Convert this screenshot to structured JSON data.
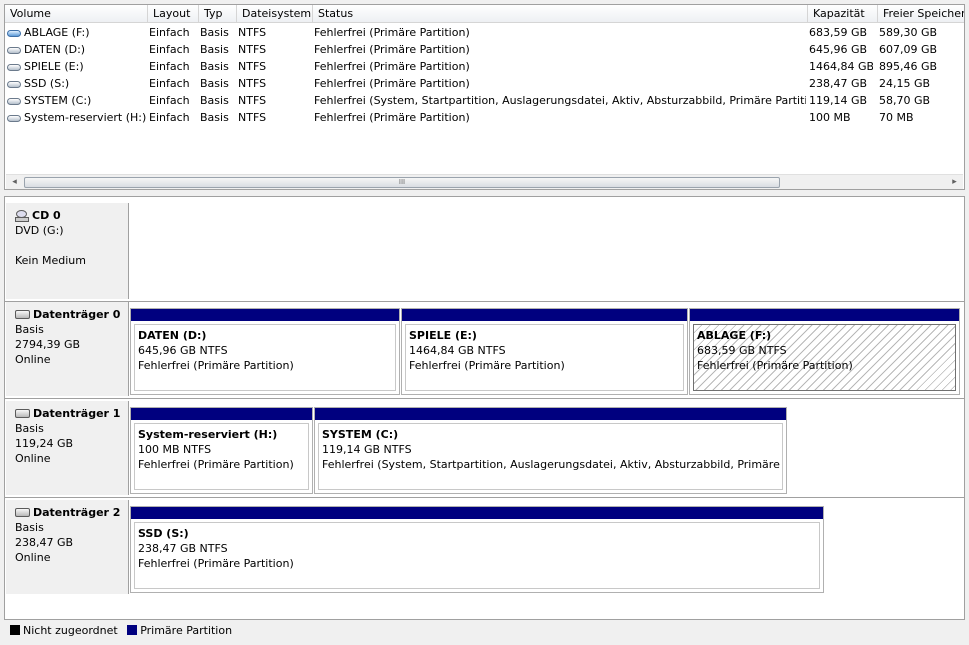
{
  "columns": [
    "Volume",
    "Layout",
    "Typ",
    "Dateisystem",
    "Status",
    "Kapazität",
    "Freier Speicher"
  ],
  "volumes": [
    {
      "name": "ABLAGE (F:)",
      "layout": "Einfach",
      "type": "Basis",
      "fs": "NTFS",
      "status": "Fehlerfrei (Primäre Partition)",
      "capacity": "683,59 GB",
      "free": "589,30 GB",
      "icon": "volume-icon-blue"
    },
    {
      "name": "DATEN (D:)",
      "layout": "Einfach",
      "type": "Basis",
      "fs": "NTFS",
      "status": "Fehlerfrei (Primäre Partition)",
      "capacity": "645,96 GB",
      "free": "607,09 GB",
      "icon": "volume-icon"
    },
    {
      "name": "SPIELE (E:)",
      "layout": "Einfach",
      "type": "Basis",
      "fs": "NTFS",
      "status": "Fehlerfrei (Primäre Partition)",
      "capacity": "1464,84 GB",
      "free": "895,46 GB",
      "icon": "volume-icon"
    },
    {
      "name": "SSD (S:)",
      "layout": "Einfach",
      "type": "Basis",
      "fs": "NTFS",
      "status": "Fehlerfrei (Primäre Partition)",
      "capacity": "238,47 GB",
      "free": "24,15 GB",
      "icon": "volume-icon"
    },
    {
      "name": "SYSTEM (C:)",
      "layout": "Einfach",
      "type": "Basis",
      "fs": "NTFS",
      "status": "Fehlerfrei (System, Startpartition, Auslagerungsdatei, Aktiv, Absturzabbild, Primäre Partition)",
      "capacity": "119,14 GB",
      "free": "58,70 GB",
      "icon": "volume-icon"
    },
    {
      "name": "System-reserviert (H:)",
      "layout": "Einfach",
      "type": "Basis",
      "fs": "NTFS",
      "status": "Fehlerfrei (Primäre Partition)",
      "capacity": "100 MB",
      "free": "70 MB",
      "icon": "volume-icon"
    }
  ],
  "scrollbar": {
    "left_arrow": "◂",
    "right_arrow": "▸",
    "grip": "III"
  },
  "disks": [
    {
      "title": "CD 0",
      "line1": "DVD (G:)",
      "line2": "",
      "line3": "Kein Medium",
      "icon": "cd-drive-icon"
    },
    {
      "title": "Datenträger 0",
      "line1": "Basis",
      "line2": "2794,39 GB",
      "line3": "Online",
      "icon": "disk-icon",
      "partitions": [
        {
          "name": "DATEN  (D:)",
          "size": "645,96 GB NTFS",
          "status": "Fehlerfrei (Primäre Partition)"
        },
        {
          "name": "SPIELE  (E:)",
          "size": "1464,84 GB NTFS",
          "status": "Fehlerfrei (Primäre Partition)"
        },
        {
          "name": "ABLAGE  (F:)",
          "size": "683,59 GB NTFS",
          "status": "Fehlerfrei (Primäre Partition)",
          "selected": true
        }
      ]
    },
    {
      "title": "Datenträger 1",
      "line1": "Basis",
      "line2": "119,24 GB",
      "line3": "Online",
      "icon": "disk-icon",
      "partitions": [
        {
          "name": "System-reserviert  (H:)",
          "size": "100 MB NTFS",
          "status": "Fehlerfrei (Primäre Partition)"
        },
        {
          "name": "SYSTEM  (C:)",
          "size": "119,14 GB NTFS",
          "status": "Fehlerfrei (System, Startpartition, Auslagerungsdatei, Aktiv, Absturzabbild, Primäre Partition)"
        }
      ]
    },
    {
      "title": "Datenträger 2",
      "line1": "Basis",
      "line2": "238,47 GB",
      "line3": "Online",
      "icon": "disk-icon",
      "partitions": [
        {
          "name": "SSD  (S:)",
          "size": "238,47 GB NTFS",
          "status": "Fehlerfrei (Primäre Partition)"
        }
      ]
    }
  ],
  "legend": [
    {
      "label": "Nicht zugeordnet",
      "color": "#000000"
    },
    {
      "label": "Primäre Partition",
      "color": "#00007f"
    }
  ]
}
